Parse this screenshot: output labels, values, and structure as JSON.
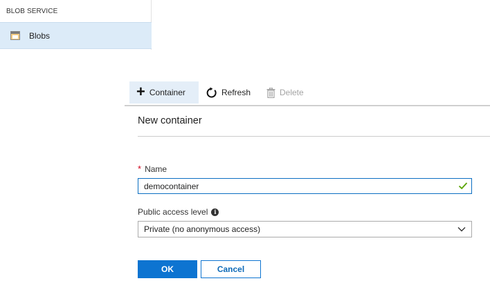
{
  "sidebar": {
    "section_label": "BLOB SERVICE",
    "items": [
      {
        "label": "Blobs",
        "icon": "blob-container-icon"
      }
    ]
  },
  "command_bar": {
    "container_label": "Container",
    "refresh_label": "Refresh",
    "delete_label": "Delete"
  },
  "panel": {
    "title": "New container",
    "name": {
      "label": "Name",
      "required": "*",
      "value": "democontainer"
    },
    "access_level": {
      "label": "Public access level",
      "info_glyph": "i",
      "selected": "Private (no anonymous access)"
    },
    "ok_label": "OK",
    "cancel_label": "Cancel"
  },
  "colors": {
    "accent": "#0d74d1",
    "selected_nav_bg": "#dcebf8",
    "valid_check": "#57a300",
    "required": "#d0021b"
  }
}
